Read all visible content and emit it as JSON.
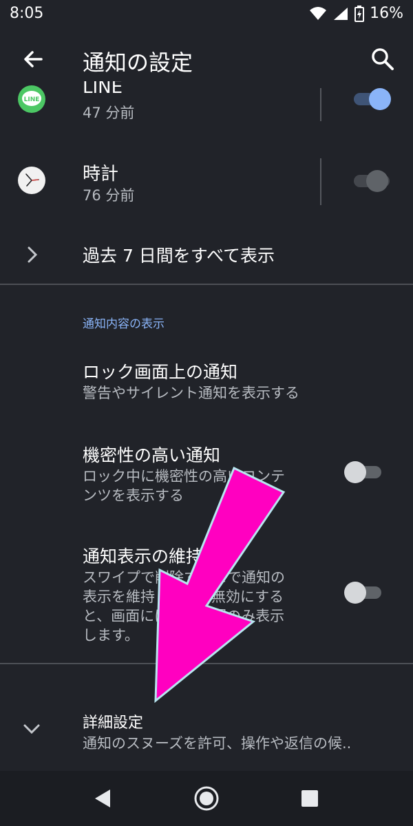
{
  "status_bar": {
    "time": "8:05",
    "battery": "16%"
  },
  "app_bar": {
    "title": "通知の設定"
  },
  "apps": [
    {
      "name": "LINE",
      "last_notified": "47 分前",
      "icon": "line-logo",
      "enabled": true
    },
    {
      "name": "時計",
      "last_notified": "76 分前",
      "icon": "clock-icon",
      "enabled": false
    }
  ],
  "see_all": "過去 7 日間をすべて表示",
  "section": {
    "label": "通知内容の表示"
  },
  "lock_screen": {
    "title": "ロック画面上の通知",
    "summary": "警告やサイレント通知を表示する"
  },
  "sensitive": {
    "title": "機密性の高い通知",
    "summary_line1": "ロック中に機密性の高いコンテ",
    "summary_line2": "ンツを表示する",
    "enabled": false
  },
  "keep_display": {
    "title": "通知表示の維持",
    "summary_line1": "スワイプで削除するまで通知の",
    "summary_line2": "表示を維持します。無効にする",
    "summary_line3": "と、画面には一定時間のみ表示",
    "summary_line4": "します。",
    "enabled": false
  },
  "advanced": {
    "title": "詳細設定",
    "summary": "通知のスヌーズを許可、操作や返信の候.."
  },
  "colors": {
    "accent": "#8ab4f8",
    "annotation_arrow": "#ff00c0"
  }
}
